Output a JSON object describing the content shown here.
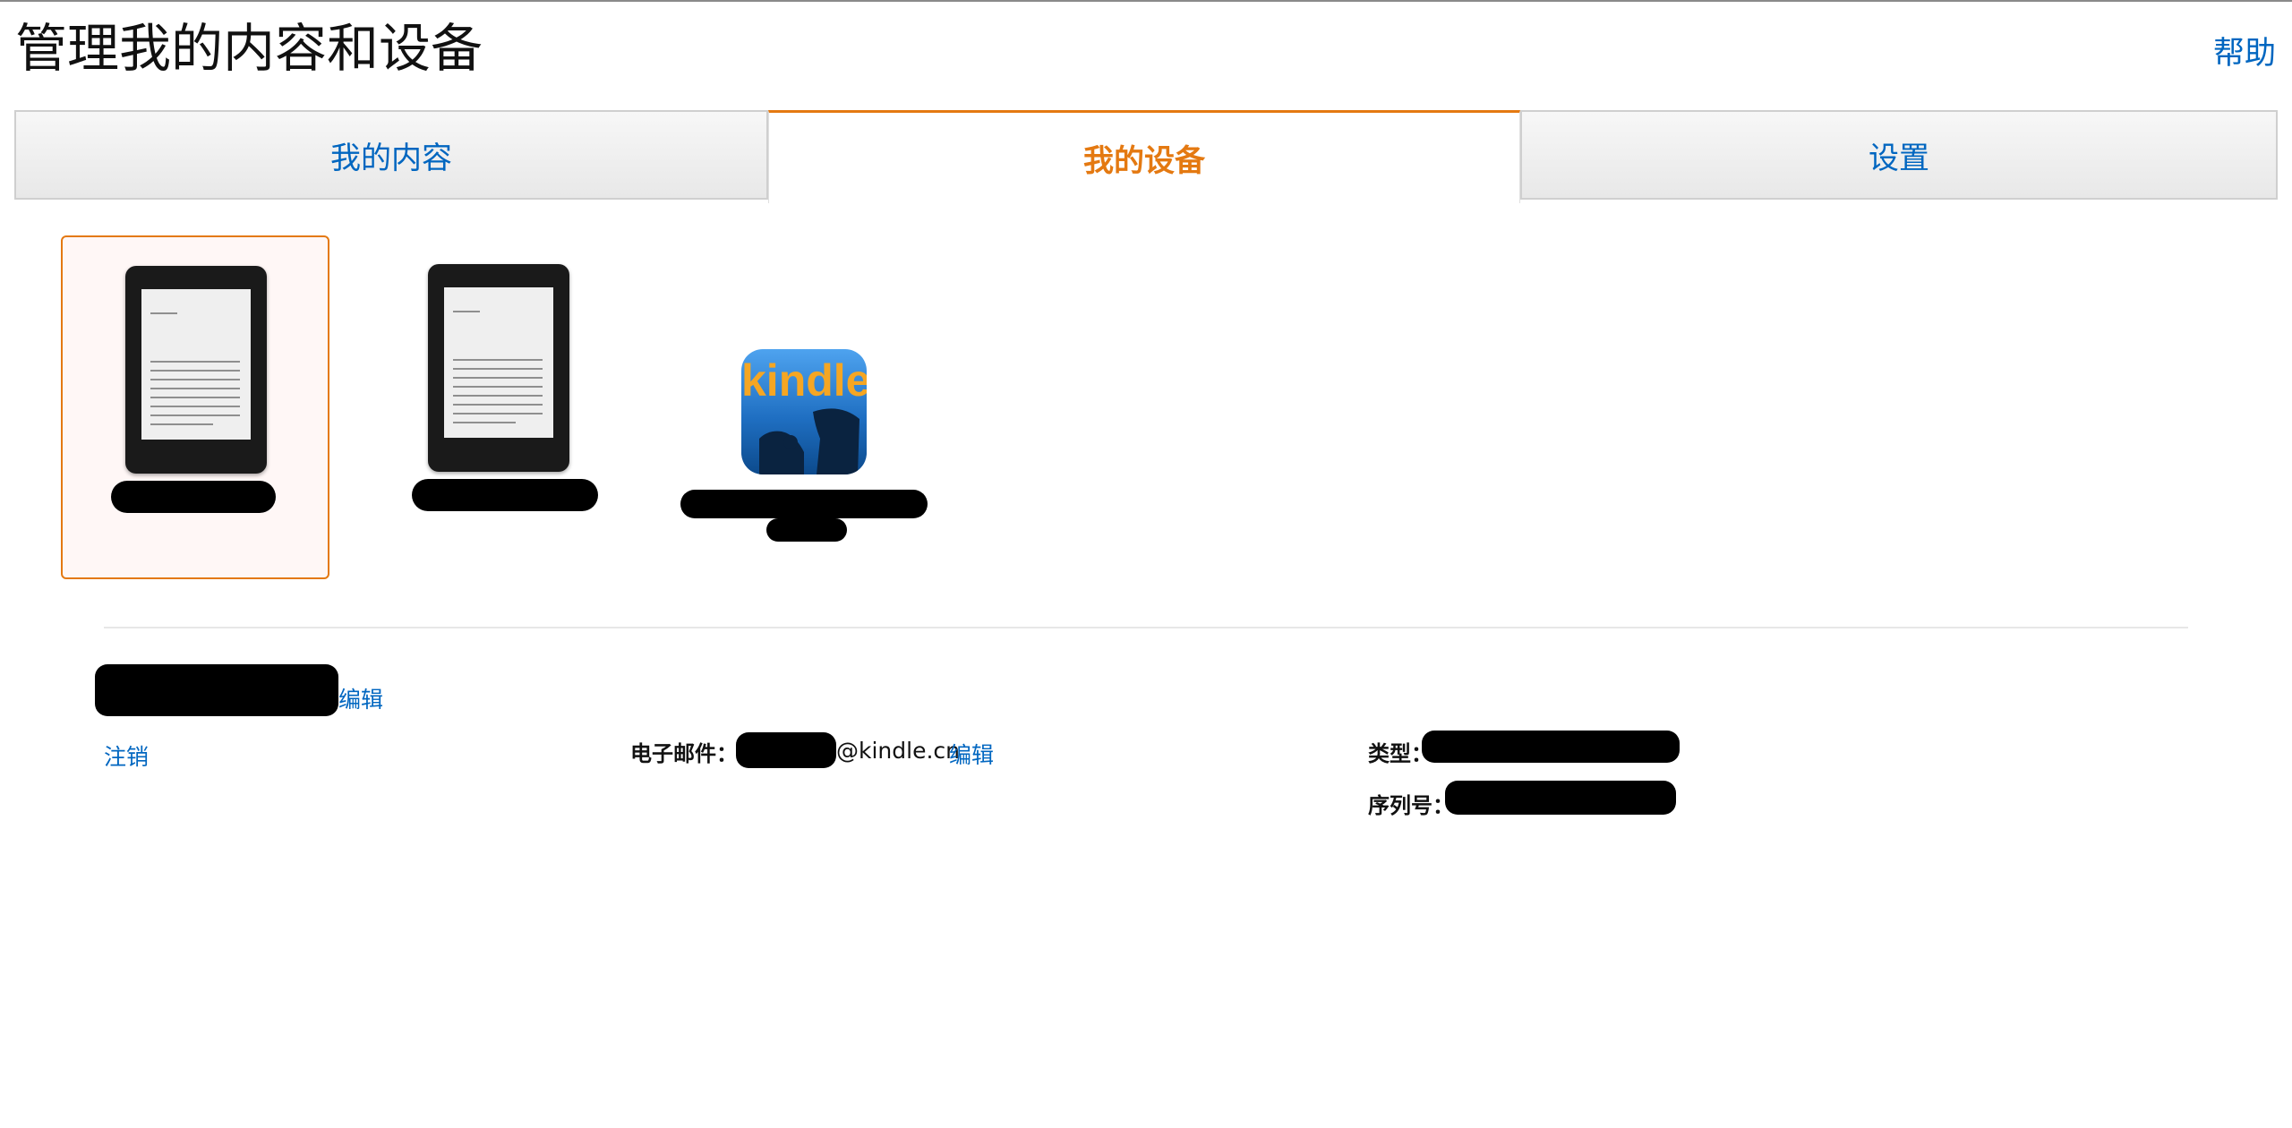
{
  "header": {
    "title": "管理我的内容和设备",
    "help": "帮助"
  },
  "tabs": [
    {
      "label": "我的内容",
      "active": false
    },
    {
      "label": "我的设备",
      "active": true
    },
    {
      "label": "设置",
      "active": false
    }
  ],
  "devices": [
    {
      "kind": "kindle-paperwhite",
      "selected": true
    },
    {
      "kind": "kindle-paperwhite",
      "selected": false
    },
    {
      "kind": "kindle-app",
      "app_logo_text": "kindle",
      "selected": false
    }
  ],
  "detail": {
    "edit_name": "编辑",
    "deregister": "注销",
    "email_label": "电子邮件：",
    "email_domain": "@kindle.cn",
    "edit_email": "编辑",
    "type_label": "类型：",
    "serial_label": "序列号："
  },
  "colors": {
    "link": "#0066c0",
    "active_tab": "#e47911",
    "selected_border": "#e47911"
  }
}
